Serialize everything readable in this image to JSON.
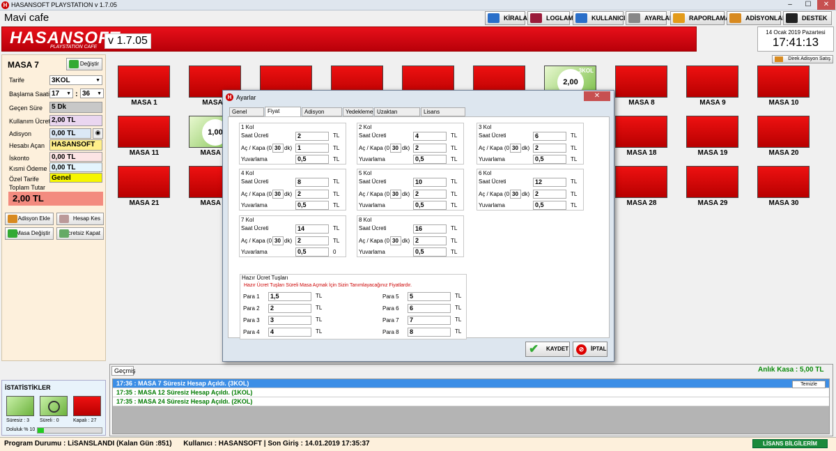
{
  "window": {
    "title": "HASANSOFT PLAYSTATION v 1.7.05",
    "cafe_name": "Mavi cafe"
  },
  "toolbar": [
    {
      "label": "KİRALAMA",
      "color": "#2a6fc9"
    },
    {
      "label": "LOGLAMA",
      "color": "#9b1b3a"
    },
    {
      "label": "KULLANICILAR",
      "color": "#2a6fc9"
    },
    {
      "label": "AYARLAR",
      "color": "#888888"
    },
    {
      "label": "RAPORLAMA",
      "color": "#e39b1a"
    },
    {
      "label": "ADİSYONLAR",
      "color": "#d88a20"
    },
    {
      "label": "DESTEK",
      "color": "#222222"
    }
  ],
  "banner": {
    "brand": "HASANSOFT",
    "sub": "PLAYSTATION CAFE",
    "version": "v 1.7.05"
  },
  "clock": {
    "date": "14 Ocak 2019 Pazartesi",
    "time": "17:41:13"
  },
  "direct_sale": "Direk Adisyon Satış",
  "left": {
    "table": "MASA 7",
    "change": "Değiştir",
    "tarife_label": "Tarife",
    "tarife": "3KOL",
    "start_label": "Başlama Saati",
    "start_h": "17",
    "start_m": "36",
    "sep": ":",
    "elapsed_label": "Geçen Süre",
    "elapsed": "5 Dk",
    "usage_label": "Kullanım Ücreti",
    "usage": "2,00 TL",
    "adisyon_label": "Adisyon",
    "adisyon": "0,00 TL",
    "opener_label": "Hesabı Açan",
    "opener": "HASANSOFT",
    "discount_label": "İskonto",
    "discount": "0,00 TL",
    "partial_label": "Kısmi Ödeme",
    "partial": "0,00 TL",
    "special_label": "Özel Tarife",
    "special": "Genel",
    "total_label": "Toplam Tutar",
    "total": "2,00 TL",
    "btn_add": "Adisyon Ekle",
    "btn_close": "Hesap Kes",
    "btn_change": "Masa Değiştir",
    "btn_free": "Ücretsiz Kapat"
  },
  "tiles_row1": [
    {
      "name": "MASA 1"
    },
    {
      "name": "MASA 2"
    },
    {
      "name": "MASA 3"
    },
    {
      "name": "MASA 4"
    },
    {
      "name": "MASA 5"
    },
    {
      "name": "MASA 6"
    },
    {
      "name": "MASA 7",
      "active": true,
      "price": "2,00",
      "badge": "3KOL"
    },
    {
      "name": "MASA 8"
    },
    {
      "name": "MASA 9"
    },
    {
      "name": "MASA 10"
    }
  ],
  "tiles_row2": [
    {
      "name": "MASA 11"
    },
    {
      "name": "MASA 12",
      "active": true,
      "price": "1,00"
    },
    {
      "name": "MASA 18"
    },
    {
      "name": "MASA 19"
    },
    {
      "name": "MASA 20"
    }
  ],
  "tiles_row3": [
    {
      "name": "MASA 21"
    },
    {
      "name": "MASA 22"
    },
    {
      "name": "MASA 28"
    },
    {
      "name": "MASA 29"
    },
    {
      "name": "MASA 30"
    }
  ],
  "history": {
    "tab": "Geçmiş",
    "kasa": "Anlık Kasa : 5,00 TL",
    "clear": "Temizle",
    "rows": [
      "17:36 : MASA 7 Süresiz Hesap Açıldı. (3KOL)",
      "17:35 : MASA 12 Süresiz Hesap Açıldı. (1KOL)",
      "17:35 : MASA 24 Süresiz Hesap Açıldı. (2KOL)"
    ]
  },
  "stats": {
    "title": "İSTATİSTİKLER",
    "free": "Süresiz : 3",
    "timed": "Süreli : 0",
    "closed": "Kapalı : 27",
    "fill": "Doluluk % 10",
    "fill_value": 10
  },
  "status": {
    "text": "Program Durumu : LiSANSLANDI (Kalan Gün :851)      Kullanıcı : HASANSOFT | Son Giriş : 14.01.2019 17:35:37",
    "license": "LİSANS BİLGİLERİM"
  },
  "dialog": {
    "title": "Ayarlar",
    "tabs": [
      "Genel Ayarlar",
      "Fiyat Ayarları",
      "Adisyon Ayarları",
      "Yedekleme",
      "Uzaktan Yönetim",
      "Lisans Bilgilerim"
    ],
    "l_rate": "Saat Ücreti",
    "l_toggle_a": "Aç / Kapa (0 -",
    "l_toggle_b": "dk)",
    "l_round": "Yuvarlama",
    "tl": "TL",
    "groups": [
      {
        "title": "1 Kol",
        "rate": "2",
        "mins": "30",
        "toggle": "1",
        "round": "0,5",
        "u3": "TL"
      },
      {
        "title": "2 Kol",
        "rate": "4",
        "mins": "30",
        "toggle": "2",
        "round": "0,5",
        "u3": "TL"
      },
      {
        "title": "3 Kol",
        "rate": "6",
        "mins": "30",
        "toggle": "2",
        "round": "0,5",
        "u3": "TL"
      },
      {
        "title": "4 Kol",
        "rate": "8",
        "mins": "30",
        "toggle": "2",
        "round": "0,5",
        "u3": "TL"
      },
      {
        "title": "5 Kol",
        "rate": "10",
        "mins": "30",
        "toggle": "2",
        "round": "0,5",
        "u3": "TL"
      },
      {
        "title": "6 Kol",
        "rate": "12",
        "mins": "30",
        "toggle": "2",
        "round": "0,5",
        "u3": "TL"
      },
      {
        "title": "7 Kol",
        "rate": "14",
        "mins": "30",
        "toggle": "2",
        "round": "0,5",
        "u3": "0"
      },
      {
        "title": "8 Kol",
        "rate": "16",
        "mins": "30",
        "toggle": "2",
        "round": "0,5",
        "u3": "TL"
      }
    ],
    "preset_title": "Hazır Ücret Tuşları",
    "preset_note": "Hazır Ücret Tuşları Süreli Masa Açmak İçin Sizin Tanımlayacağınız Fiyatlardır.",
    "presets": [
      {
        "label": "Para 1",
        "value": "1,5"
      },
      {
        "label": "Para 2",
        "value": "2"
      },
      {
        "label": "Para 3",
        "value": "3"
      },
      {
        "label": "Para 4",
        "value": "4"
      },
      {
        "label": "Para 5",
        "value": "5"
      },
      {
        "label": "Para 6",
        "value": "6"
      },
      {
        "label": "Para 7",
        "value": "7"
      },
      {
        "label": "Para 8",
        "value": "8"
      }
    ],
    "save": "KAYDET",
    "cancel": "İPTAL"
  }
}
